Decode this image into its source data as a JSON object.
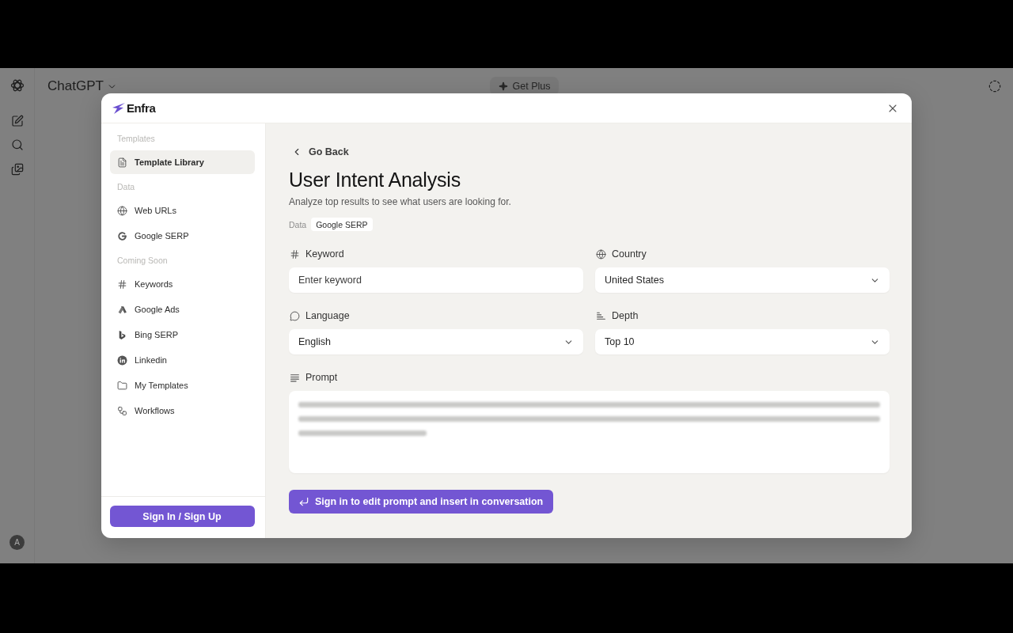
{
  "app": {
    "title": "ChatGPT",
    "upgrade_button": "Get Plus",
    "avatar_initial": "A"
  },
  "dialog": {
    "brand": "Enfra",
    "sidebar": {
      "sections": [
        {
          "heading": "Templates",
          "items": [
            {
              "label": "Template Library",
              "selected": true
            }
          ]
        },
        {
          "heading": "Data",
          "items": [
            {
              "label": "Web URLs",
              "selected": false
            },
            {
              "label": "Google SERP",
              "selected": false
            }
          ]
        },
        {
          "heading": "Coming Soon",
          "items": [
            {
              "label": "Keywords",
              "selected": false
            },
            {
              "label": "Google Ads",
              "selected": false
            },
            {
              "label": "Bing SERP",
              "selected": false
            },
            {
              "label": "Linkedin",
              "selected": false
            },
            {
              "label": "My Templates",
              "selected": false
            },
            {
              "label": "Workflows",
              "selected": false
            }
          ]
        }
      ],
      "sign_in_button": "Sign In / Sign Up"
    },
    "content": {
      "back_link": "Go Back",
      "title": "User Intent Analysis",
      "description": "Analyze top results to see what users are looking for.",
      "data_label": "Data",
      "data_tag": "Google SERP",
      "fields": [
        {
          "kind": "text",
          "label": "Keyword",
          "placeholder": "Enter keyword"
        },
        {
          "kind": "select",
          "label": "Country",
          "value": "United States"
        },
        {
          "kind": "select",
          "label": "Language",
          "value": "English"
        },
        {
          "kind": "select",
          "label": "Depth",
          "value": "Top 10"
        }
      ],
      "prompt": {
        "label": "Prompt"
      },
      "submit_button": "Sign in to edit prompt and insert in conversation"
    }
  }
}
